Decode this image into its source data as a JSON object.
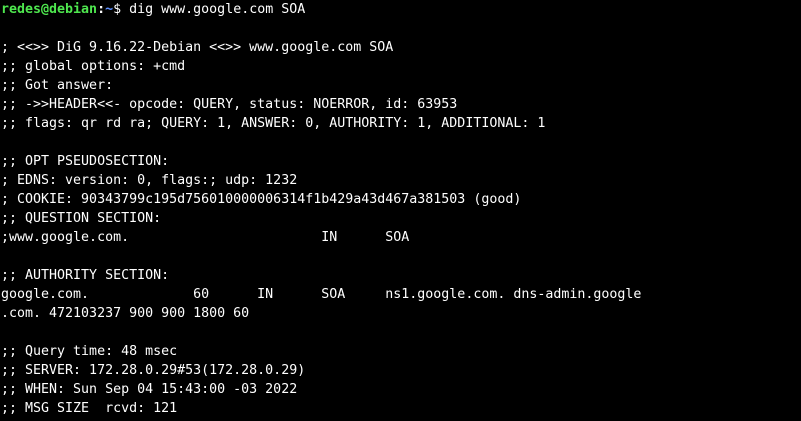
{
  "prompt": {
    "user_host": "redes@debian",
    "separator": ":",
    "path": "~",
    "dollar": "$ ",
    "command": "dig www.google.com SOA"
  },
  "output_lines": [
    "",
    "; <<>> DiG 9.16.22-Debian <<>> www.google.com SOA",
    ";; global options: +cmd",
    ";; Got answer:",
    ";; ->>HEADER<<- opcode: QUERY, status: NOERROR, id: 63953",
    ";; flags: qr rd ra; QUERY: 1, ANSWER: 0, AUTHORITY: 1, ADDITIONAL: 1",
    "",
    ";; OPT PSEUDOSECTION:",
    "; EDNS: version: 0, flags:; udp: 1232",
    "; COOKIE: 90343799c195d756010000006314f1b429a43d467a381503 (good)",
    ";; QUESTION SECTION:",
    ";www.google.com.                        IN      SOA",
    "",
    ";; AUTHORITY SECTION:",
    "google.com.             60      IN      SOA     ns1.google.com. dns-admin.google",
    ".com. 472103237 900 900 1800 60",
    "",
    ";; Query time: 48 msec",
    ";; SERVER: 172.28.0.29#53(172.28.0.29)",
    ";; WHEN: Sun Sep 04 15:43:00 -03 2022",
    ";; MSG SIZE  rcvd: 121"
  ],
  "colors": {
    "background": "#000000",
    "text": "#ffffff",
    "user_host": "#4ee64e",
    "path": "#5c8fff"
  }
}
